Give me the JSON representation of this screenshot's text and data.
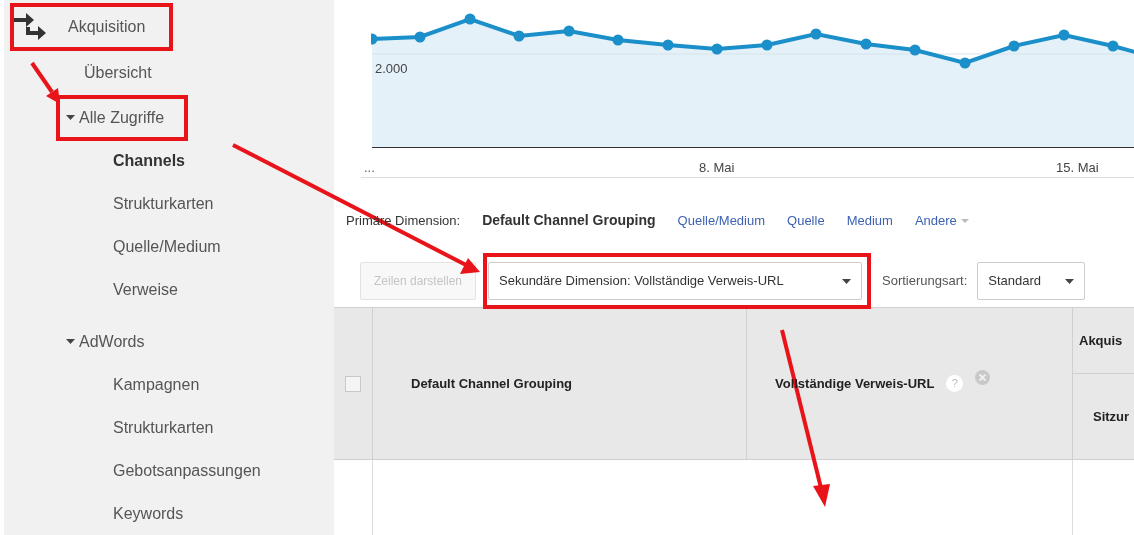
{
  "sidebar": {
    "section": {
      "label": "Akquisition"
    },
    "items": [
      {
        "label": "Übersicht"
      },
      {
        "label": "Alle Zugriffe",
        "expanded": true,
        "children": [
          {
            "label": "Channels",
            "selected": true
          },
          {
            "label": "Strukturkarten",
            "selected": false
          },
          {
            "label": "Quelle/Medium",
            "selected": false
          },
          {
            "label": "Verweise",
            "selected": false
          }
        ]
      },
      {
        "label": "AdWords",
        "expanded": true,
        "children": [
          {
            "label": "Kampagnen",
            "selected": false
          },
          {
            "label": "Strukturkarten",
            "selected": false
          },
          {
            "label": "Gebotsanpassungen",
            "selected": false
          },
          {
            "label": "Keywords",
            "selected": false
          }
        ]
      }
    ]
  },
  "chart": {
    "y_label": "2.000",
    "x_labels": [
      "...",
      "8. Mai",
      "15. Mai"
    ]
  },
  "primary_dimension": {
    "label": "Primäre Dimension:",
    "options": [
      {
        "label": "Default Channel Grouping",
        "selected": true,
        "kind": "option"
      },
      {
        "label": "Quelle/Medium",
        "selected": false,
        "kind": "option"
      },
      {
        "label": "Quelle",
        "selected": false,
        "kind": "option"
      },
      {
        "label": "Medium",
        "selected": false,
        "kind": "option"
      },
      {
        "label": "Andere",
        "selected": false,
        "kind": "menu"
      }
    ]
  },
  "toolbar": {
    "show_rows": {
      "label": "Zeilen darstellen",
      "disabled": true
    },
    "secondary_dimension": "Sekundäre Dimension: Vollständige Verweis-URL",
    "sort_label": "Sortierungsart:",
    "sort_value": "Standard"
  },
  "table": {
    "select_all_checked": false,
    "columns": [
      {
        "label": "Default Channel Grouping",
        "help": false,
        "removable": false
      },
      {
        "label": "Vollständige Verweis-URL",
        "help": "?",
        "removable": true
      }
    ],
    "group_header": "Akquis",
    "sub_header": "Sitzur"
  }
}
